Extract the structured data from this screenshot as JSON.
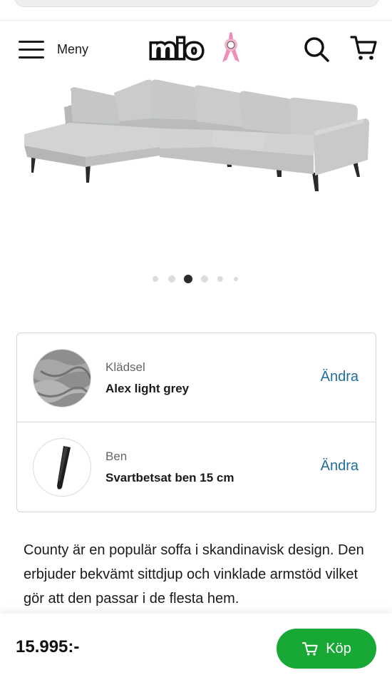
{
  "header": {
    "menu_label": "Meny",
    "logo_text": "mio",
    "icons": {
      "menu": "hamburger-icon",
      "search": "search-icon",
      "cart": "cart-icon",
      "badge": "pink-ribbon-icon"
    }
  },
  "carousel": {
    "slide_count": 6,
    "active_index": 2
  },
  "options": [
    {
      "label": "Klädsel",
      "value": "Alex light grey",
      "action": "Ändra",
      "thumb": "fabric-swatch"
    },
    {
      "label": "Ben",
      "value": "Svartbetsat ben 15 cm",
      "action": "Ändra",
      "thumb": "leg-swatch"
    }
  ],
  "description": "County är en populär soffa i skandinavisk design. Den erbjuder bekvämt sittdjup och vinklade armstöd vilket gör att den passar i de flesta hem.",
  "purchase": {
    "price": "15.995:-",
    "buy_label": "Köp",
    "icon": "cart-icon"
  },
  "colors": {
    "accent_link": "#1f6e9e",
    "buy_green": "#17a835",
    "sofa_grey": "#c9cccb"
  }
}
